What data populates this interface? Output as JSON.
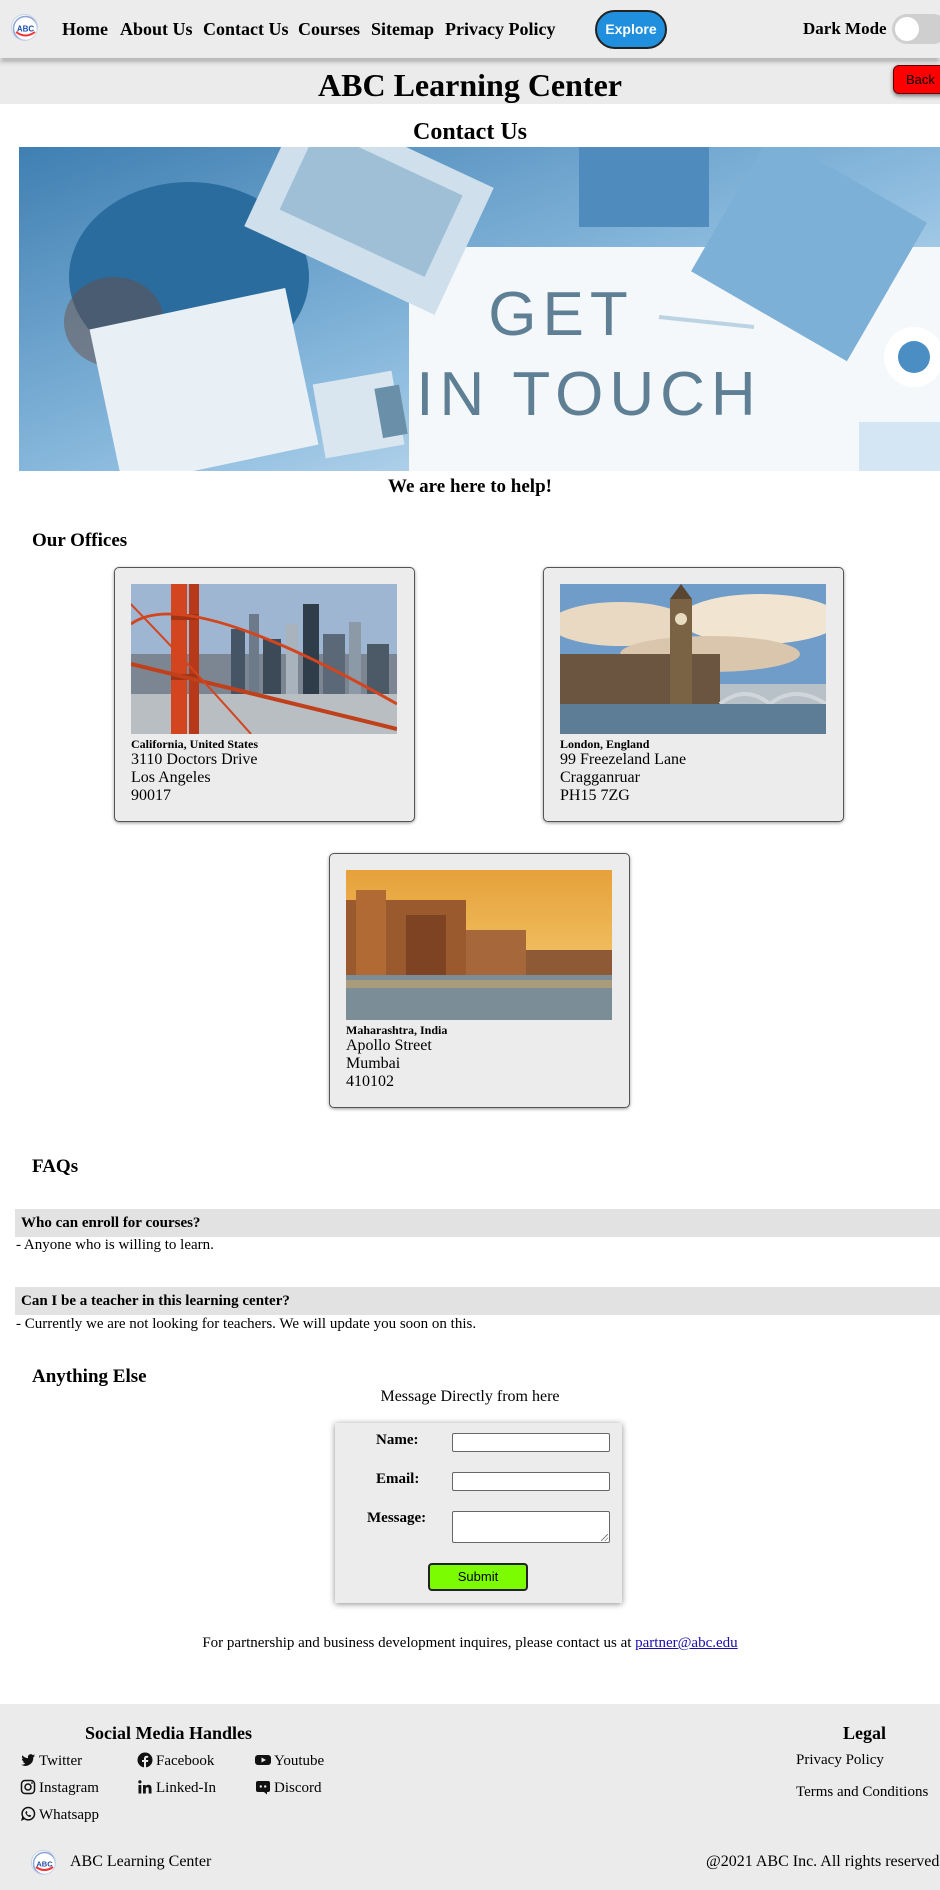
{
  "nav": {
    "logo_text": "ABC",
    "links": [
      "Home",
      "About Us",
      "Contact Us",
      "Courses",
      "Sitemap",
      "Privacy Policy"
    ],
    "explore_label": "Explore",
    "dark_mode_label": "Dark Mode",
    "dark_mode_on": false
  },
  "header": {
    "site_title": "ABC Learning Center",
    "back_label": "Back"
  },
  "page": {
    "heading": "Contact Us",
    "hero_text": [
      "GET",
      "IN TOUCH"
    ],
    "tagline": "We are here to help!"
  },
  "offices": {
    "heading": "Our Offices",
    "items": [
      {
        "region": "California, United States",
        "lines": [
          "3110 Doctors Drive",
          "Los Angeles",
          "90017"
        ]
      },
      {
        "region": "London, England",
        "lines": [
          "99 Freezeland Lane",
          "Cragganruar",
          "PH15 7ZG"
        ]
      },
      {
        "region": "Maharashtra, India",
        "lines": [
          "Apollo Street",
          "Mumbai",
          "410102"
        ]
      }
    ]
  },
  "faqs": {
    "heading": "FAQs",
    "items": [
      {
        "question": "Who can enroll for courses?",
        "answer": "- Anyone who is willing to learn."
      },
      {
        "question": "Can I be a teacher in this learning center?",
        "answer": "- Currently we are not looking for teachers. We will update you soon on this."
      }
    ]
  },
  "contact_form": {
    "heading": "Anything Else",
    "subheading": "Message Directly from here",
    "name_label": "Name:",
    "email_label": "Email:",
    "message_label": "Message:",
    "name_value": "",
    "email_value": "",
    "submit_label": "Submit"
  },
  "partner": {
    "text": "For partnership and business development inquires, please contact us at",
    "email": "partner@abc.edu"
  },
  "footer": {
    "social_heading": "Social Media Handles",
    "social": [
      {
        "label": "Twitter",
        "icon": "twitter-icon"
      },
      {
        "label": "Facebook",
        "icon": "facebook-icon"
      },
      {
        "label": "Youtube",
        "icon": "youtube-icon"
      },
      {
        "label": "Instagram",
        "icon": "instagram-icon"
      },
      {
        "label": "Linked-In",
        "icon": "linkedin-icon"
      },
      {
        "label": "Discord",
        "icon": "discord-icon"
      },
      {
        "label": "Whatsapp",
        "icon": "whatsapp-icon"
      }
    ],
    "legal_heading": "Legal",
    "legal_links": [
      "Privacy Policy",
      "Terms and Conditions"
    ],
    "brand": "ABC Learning Center",
    "logo_text": "ABC",
    "copyright": "@2021 ABC Inc. All rights reserved"
  },
  "colors": {
    "explore": "#1f8fde",
    "back": "#ff0000",
    "submit": "#7cfc00",
    "footer_bg": "#ebebeb"
  }
}
